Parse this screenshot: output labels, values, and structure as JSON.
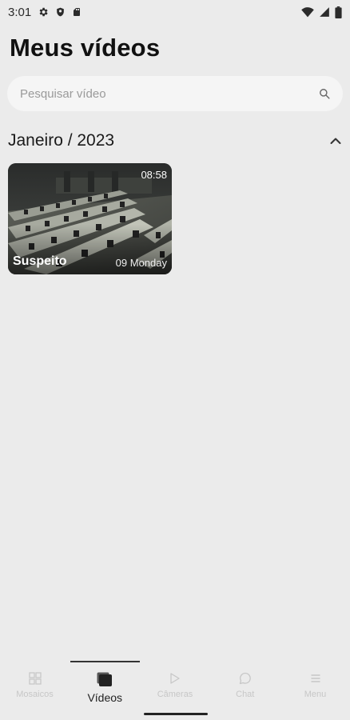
{
  "status_bar": {
    "time": "3:01",
    "left_icons": [
      "gear-icon",
      "shield-icon",
      "sd-card-icon"
    ],
    "right_icons": [
      "wifi-icon",
      "signal-icon",
      "battery-icon"
    ]
  },
  "header": {
    "title": "Meus vídeos"
  },
  "search": {
    "placeholder": "Pesquisar vídeo",
    "value": ""
  },
  "section": {
    "title": "Janeiro / 2023",
    "expanded": true
  },
  "videos": [
    {
      "title": "Suspeito",
      "duration": "08:58",
      "date": "09 Monday"
    }
  ],
  "bottom_nav": {
    "items": [
      {
        "label": "Mosaicos",
        "icon": "grid-icon",
        "active": false
      },
      {
        "label": "Vídeos",
        "icon": "videos-icon",
        "active": true
      },
      {
        "label": "Câmeras",
        "icon": "play-icon",
        "active": false
      },
      {
        "label": "Chat",
        "icon": "chat-icon",
        "active": false
      },
      {
        "label": "Menu",
        "icon": "menu-icon",
        "active": false
      }
    ]
  },
  "colors": {
    "background": "#ebebeb",
    "inactive_nav": "#c7c7c7",
    "active_nav": "#222222"
  }
}
